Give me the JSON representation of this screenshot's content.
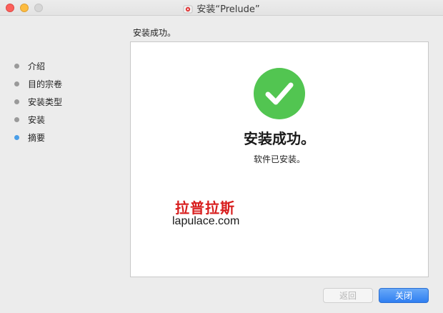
{
  "window": {
    "title": "安装“Prelude”"
  },
  "colors": {
    "accent": "#2f7ff1",
    "success": "#52c551",
    "watermark": "#d81e1e",
    "active_step": "#4a9ee8"
  },
  "header": {
    "heading": "安装成功。"
  },
  "sidebar": {
    "steps": [
      {
        "label": "介绍",
        "active": false
      },
      {
        "label": "目的宗卷",
        "active": false
      },
      {
        "label": "安装类型",
        "active": false
      },
      {
        "label": "安装",
        "active": false
      },
      {
        "label": "摘要",
        "active": true
      }
    ]
  },
  "main": {
    "icon": "checkmark-icon",
    "title": "安装成功。",
    "subtitle": "软件已安装。",
    "watermark_cn": "拉普拉斯",
    "watermark_url": "lapulace.com"
  },
  "footer": {
    "back_label": "返回",
    "back_enabled": false,
    "close_label": "关闭"
  }
}
